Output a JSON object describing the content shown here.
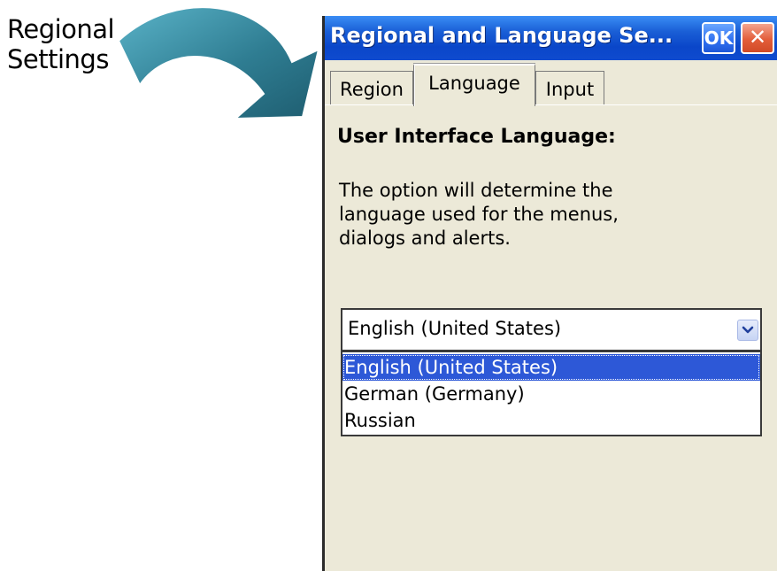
{
  "annotation": {
    "line1": "Regional",
    "line2": "Settings"
  },
  "window": {
    "title": "Regional and Language Se...",
    "ok_label": "OK",
    "close_label": "✕"
  },
  "tabs": [
    {
      "label": "Region",
      "active": false
    },
    {
      "label": "Language",
      "active": true
    },
    {
      "label": "Input",
      "active": false
    }
  ],
  "content": {
    "heading": "User Interface Language:",
    "description": "The option will determine the language used for the menus, dialogs and alerts."
  },
  "language_select": {
    "value": "English (United States)",
    "options": [
      {
        "label": "English (United States)",
        "selected": true
      },
      {
        "label": "German (Germany)",
        "selected": false
      },
      {
        "label": "Russian",
        "selected": false
      }
    ]
  },
  "icons": {
    "arrow": "curved-arrow-icon",
    "dropdown": "chevron-down-icon",
    "close": "close-icon"
  },
  "colors": {
    "titlebar": "#0a46c9",
    "window_bg": "#ece9d8",
    "selection": "#2d58d7",
    "arrow": "#2f7d92"
  }
}
